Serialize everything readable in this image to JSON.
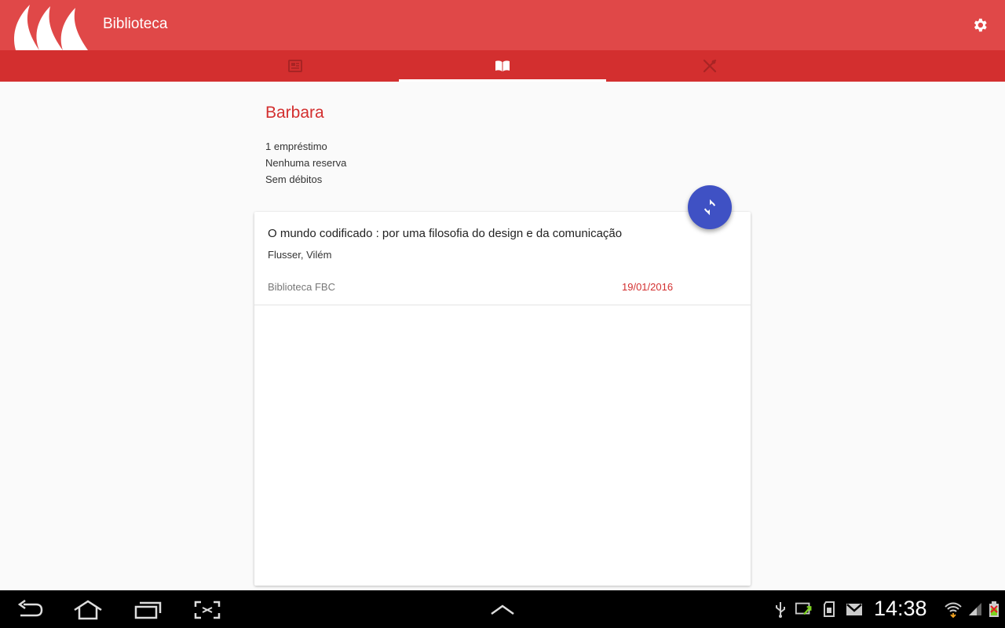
{
  "app": {
    "title": "Biblioteca",
    "colors": {
      "primary": "#e04848",
      "primary_dark": "#d32f2f",
      "accent": "#3f51c4"
    }
  },
  "tabs": [
    {
      "icon": "newspaper-icon",
      "selected": false
    },
    {
      "icon": "open-book-icon",
      "selected": true
    },
    {
      "icon": "restaurant-icon",
      "selected": false
    }
  ],
  "user": {
    "name": "Barbara",
    "loans": "1 empréstimo",
    "reservations": "Nenhuma reserva",
    "debts": "Sem débitos"
  },
  "loans": [
    {
      "title": "O mundo codificado : por uma filosofia do design e da comunicação",
      "author": "Flusser, Vilém",
      "library": "Biblioteca FBC",
      "due_date": "19/01/2016"
    }
  ],
  "fab": {
    "icon": "refresh-icon"
  },
  "system_bar": {
    "time": "14:38",
    "nav_icons": [
      "back-icon",
      "home-icon",
      "recent-apps-icon",
      "screenshot-icon",
      "chevron-up-icon"
    ],
    "status_icons": [
      "usb-icon",
      "screen-mirror-icon",
      "sd-card-icon",
      "gmail-icon",
      "wifi-icon",
      "signal-icon",
      "battery-icon"
    ]
  }
}
